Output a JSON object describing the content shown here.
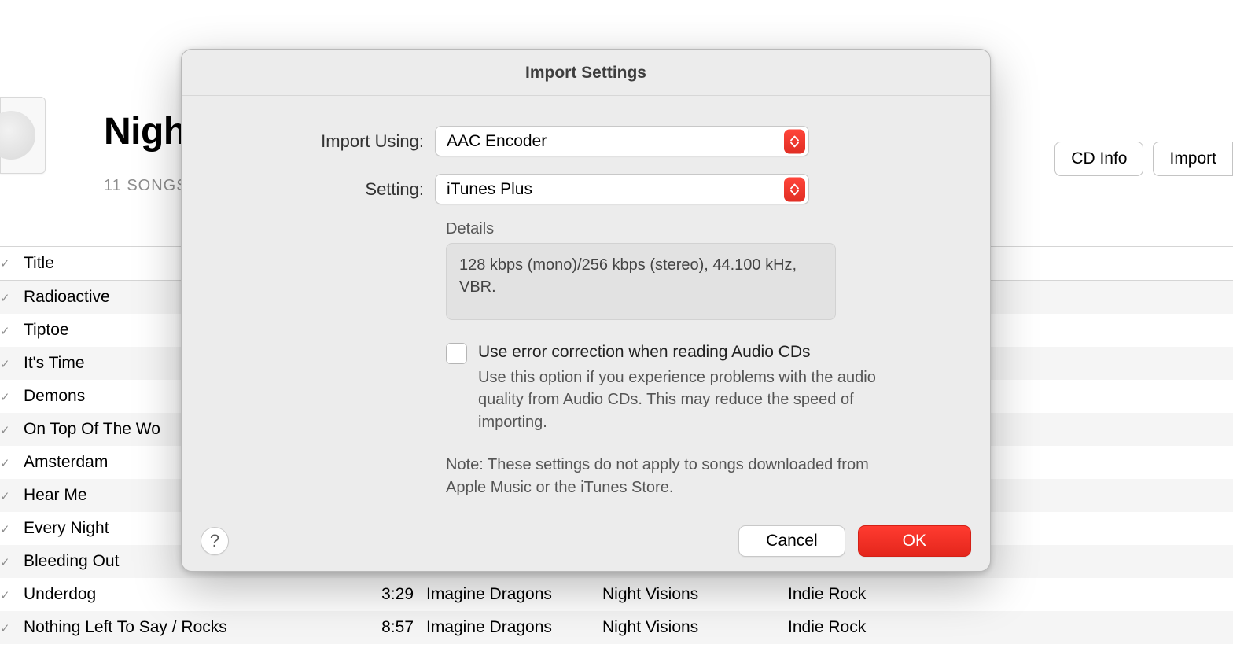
{
  "background": {
    "album_title_partial": "Nigh",
    "songs_count_partial": "11 SONGS",
    "buttons": {
      "cd_info": "CD Info",
      "import_partial": "Import "
    },
    "header_title": "Title",
    "tracks": [
      {
        "title": "Radioactive"
      },
      {
        "title": "Tiptoe"
      },
      {
        "title": "It's Time"
      },
      {
        "title": "Demons"
      },
      {
        "title": "On Top Of The Wo"
      },
      {
        "title": "Amsterdam"
      },
      {
        "title": "Hear Me"
      },
      {
        "title": "Every Night"
      },
      {
        "title": "Bleeding Out"
      },
      {
        "title": "Underdog",
        "time": "3:29",
        "artist": "Imagine Dragons",
        "album": "Night Visions",
        "genre": "Indie Rock"
      },
      {
        "title": "Nothing Left To Say / Rocks",
        "time": "8:57",
        "artist": "Imagine Dragons",
        "album": "Night Visions",
        "genre": "Indie Rock"
      }
    ]
  },
  "dialog": {
    "title": "Import Settings",
    "labels": {
      "import_using": "Import Using:",
      "setting": "Setting:",
      "details": "Details"
    },
    "values": {
      "import_using": "AAC Encoder",
      "setting": "iTunes Plus"
    },
    "details_text": "128 kbps (mono)/256 kbps (stereo), 44.100 kHz, VBR.",
    "error_correction": {
      "label": "Use error correction when reading Audio CDs",
      "description": "Use this option if you experience problems with the audio quality from Audio CDs. This may reduce the speed of importing."
    },
    "note": "Note: These settings do not apply to songs downloaded from Apple Music or the iTunes Store.",
    "buttons": {
      "help": "?",
      "cancel": "Cancel",
      "ok": "OK"
    }
  }
}
